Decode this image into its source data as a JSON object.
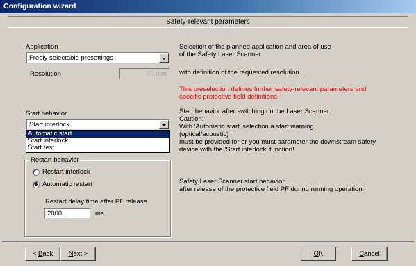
{
  "window": {
    "title": "Configuration wizard"
  },
  "header": {
    "title": "Safety-relevant parameters"
  },
  "application": {
    "label": "Application",
    "selected": "Freely selectable presettings",
    "resolution_label": "Resolution",
    "resolution_value": "70 mm"
  },
  "start_behavior": {
    "label": "Start behavior",
    "selected": "Start interlock",
    "options": [
      "Automatic start",
      "Start interlock",
      "Start test"
    ],
    "highlighted_index": 0
  },
  "restart_behavior": {
    "legend": "Restart behavior",
    "option_interlock": "Restart interlock",
    "option_automatic": "Automatic restart",
    "selected": "Automatic restart",
    "delay_label": "Restart delay time after PF release",
    "delay_value": "2000",
    "delay_unit": "ms"
  },
  "descriptions": {
    "app_line1": "Selection of the planned application and area of use",
    "app_line2": "of the Safety Laser Scanner",
    "resolution": "with definition of the requested resolution.",
    "warning_line1": "This preselection defines further safety-relevant parameters and",
    "warning_line2": "specific protective field definitions!",
    "start_line1": "Start behavior after switching on the Laser Scanner.",
    "start_line2": "Caution:",
    "start_line3": "With 'Automatic start' selection a start warning",
    "start_line4": "(optical/acoustic)",
    "start_line5": "must be provided for or you must parameter the downstream safety",
    "start_line6": "device with the 'Start interlock' function!",
    "restart_line1": "Safety Laser Scanner start behavior",
    "restart_line2": "after release of the protective field PF during running operation."
  },
  "buttons": {
    "back_prefix": "<",
    "back_u": "B",
    "back_rest": "ack",
    "next_u": "N",
    "next_rest": "ext",
    "next_suffix": ">",
    "ok_u": "O",
    "ok_rest": "K",
    "cancel_u": "C",
    "cancel_rest": "ancel"
  },
  "colors": {
    "titlebar_start": "#0a246a",
    "warning": "#ff0000",
    "selection": "#0a246a"
  }
}
